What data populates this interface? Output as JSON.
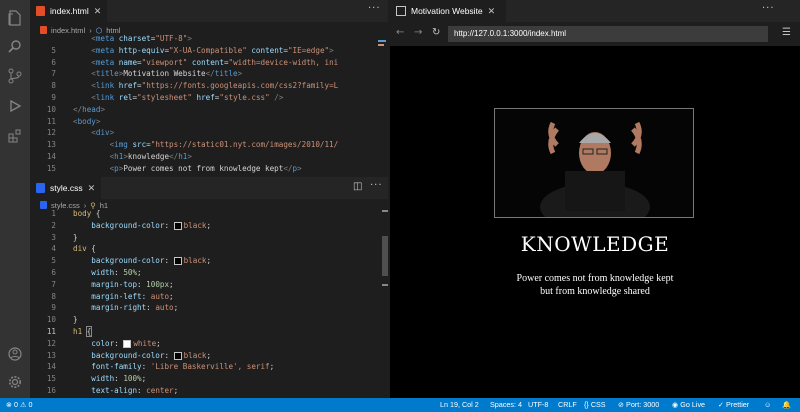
{
  "top_editor": {
    "tab_label": "index.html",
    "breadcrumb": [
      "index.html",
      "html"
    ],
    "lines": [
      {
        "n": "",
        "html": "<span class='br'>    &lt;</span><span class='tag'>meta</span> <span class='attr'>charset</span><span class='txt'>=</span><span class='str'>\"UTF-8\"</span><span class='br'>&gt;</span>"
      },
      {
        "n": "5",
        "html": "    <span class='br'>&lt;</span><span class='tag'>meta</span> <span class='attr'>http-equiv</span><span class='txt'>=</span><span class='str'>\"X-UA-Compatible\"</span> <span class='attr'>content</span><span class='txt'>=</span><span class='str'>\"IE=edge\"</span><span class='br'>&gt;</span>"
      },
      {
        "n": "6",
        "html": "    <span class='br'>&lt;</span><span class='tag'>meta</span> <span class='attr'>name</span><span class='txt'>=</span><span class='str'>\"viewport\"</span> <span class='attr'>content</span><span class='txt'>=</span><span class='str'>\"width=device-width, ini</span>"
      },
      {
        "n": "7",
        "html": "    <span class='br'>&lt;</span><span class='tag'>title</span><span class='br'>&gt;</span><span class='txt'>Motivation Website</span><span class='br'>&lt;/</span><span class='tag'>title</span><span class='br'>&gt;</span>"
      },
      {
        "n": "8",
        "html": "    <span class='br'>&lt;</span><span class='tag'>link</span> <span class='attr'>href</span><span class='txt'>=</span><span class='str'>\"https://fonts.googleapis.com/css2?family=L</span>"
      },
      {
        "n": "9",
        "html": "    <span class='br'>&lt;</span><span class='tag'>link</span> <span class='attr'>rel</span><span class='txt'>=</span><span class='str'>\"stylesheet\"</span> <span class='attr'>href</span><span class='txt'>=</span><span class='str'>\"style.css\"</span> <span class='br'>/&gt;</span>"
      },
      {
        "n": "10",
        "html": "<span class='br'>&lt;/</span><span class='tag'>head</span><span class='br'>&gt;</span>"
      },
      {
        "n": "11",
        "html": "<span class='br'>&lt;</span><span class='tag'>body</span><span class='br'>&gt;</span>"
      },
      {
        "n": "12",
        "html": "    <span class='br'>&lt;</span><span class='tag'>div</span><span class='br'>&gt;</span>"
      },
      {
        "n": "13",
        "html": "        <span class='br'>&lt;</span><span class='tag'>img</span> <span class='attr'>src</span><span class='txt'>=</span><span class='str'>\"https://static01.nyt.com/images/2010/11/</span>"
      },
      {
        "n": "14",
        "html": "        <span class='br'>&lt;</span><span class='tag'>h1</span><span class='br'>&gt;</span><span class='txt'>knowledge</span><span class='br'>&lt;/</span><span class='tag'>h1</span><span class='br'>&gt;</span>"
      },
      {
        "n": "15",
        "html": "        <span class='br'>&lt;</span><span class='tag'>p</span><span class='br'>&gt;</span><span class='txt'>Power comes not from knowledge kept</span><span class='br'>&lt;/</span><span class='tag'>p</span><span class='br'>&gt;</span>"
      }
    ]
  },
  "bottom_editor": {
    "tab_label": "style.css",
    "breadcrumb": [
      "style.css",
      "h1"
    ],
    "lines": [
      {
        "n": "1",
        "html": "<span class='sel'>body</span> <span class='txt'>{</span>"
      },
      {
        "n": "2",
        "html": "    <span class='prop'>background-color</span><span class='txt'>: </span><span class='sw' style='background:#000'></span><span class='val'>black</span><span class='txt'>;</span>"
      },
      {
        "n": "3",
        "html": "<span class='txt'>}</span>"
      },
      {
        "n": "4",
        "html": "<span class='sel'>div</span> <span class='txt'>{</span>"
      },
      {
        "n": "5",
        "html": "    <span class='prop'>background-color</span><span class='txt'>: </span><span class='sw' style='background:#000'></span><span class='val'>black</span><span class='txt'>;</span>"
      },
      {
        "n": "6",
        "html": "    <span class='prop'>width</span><span class='txt'>: </span><span class='num'>50%</span><span class='txt'>;</span>"
      },
      {
        "n": "7",
        "html": "    <span class='prop'>margin-top</span><span class='txt'>: </span><span class='num'>100px</span><span class='txt'>;</span>"
      },
      {
        "n": "8",
        "html": "    <span class='prop'>margin-left</span><span class='txt'>: </span><span class='val'>auto</span><span class='txt'>;</span>"
      },
      {
        "n": "9",
        "html": "    <span class='prop'>margin-right</span><span class='txt'>: </span><span class='val'>auto</span><span class='txt'>;</span>"
      },
      {
        "n": "10",
        "html": "<span class='txt'>}</span>"
      },
      {
        "n": "11",
        "html": "<span class='sel'>h1</span> <span class='txt' style='outline:1px solid #888'>{</span>"
      },
      {
        "n": "12",
        "html": "    <span class='prop'>color</span><span class='txt'>: </span><span class='sw' style='background:#fff'></span><span class='val'>white</span><span class='txt'>;</span>"
      },
      {
        "n": "13",
        "html": "    <span class='prop'>background-color</span><span class='txt'>: </span><span class='sw' style='background:#000'></span><span class='val'>black</span><span class='txt'>;</span>"
      },
      {
        "n": "14",
        "html": "    <span class='prop'>font-family</span><span class='txt'>: </span><span class='val'>'Libre Baskerville', serif</span><span class='txt'>;</span>"
      },
      {
        "n": "15",
        "html": "    <span class='prop'>width</span><span class='txt'>: </span><span class='num'>100%</span><span class='txt'>;</span>"
      },
      {
        "n": "16",
        "html": "    <span class='prop'>text-align</span><span class='txt'>: </span><span class='val'>center</span><span class='txt'>;</span>"
      }
    ]
  },
  "preview": {
    "tab_label": "Motivation Website",
    "url": "http://127.0.0.1:3000/index.html",
    "heading": "KNOWLEDGE",
    "paragraph_line1": "Power comes not from knowledge kept",
    "paragraph_line2": "but from knowledge shared"
  },
  "statusbar": {
    "errors": "0",
    "warnings": "0",
    "position": "Ln 19, Col 2",
    "spaces": "Spaces: 4",
    "encoding": "UTF-8",
    "eol": "CRLF",
    "language": "CSS",
    "port": "Port: 3000",
    "golive": "Go Live",
    "prettier": "Prettier"
  }
}
